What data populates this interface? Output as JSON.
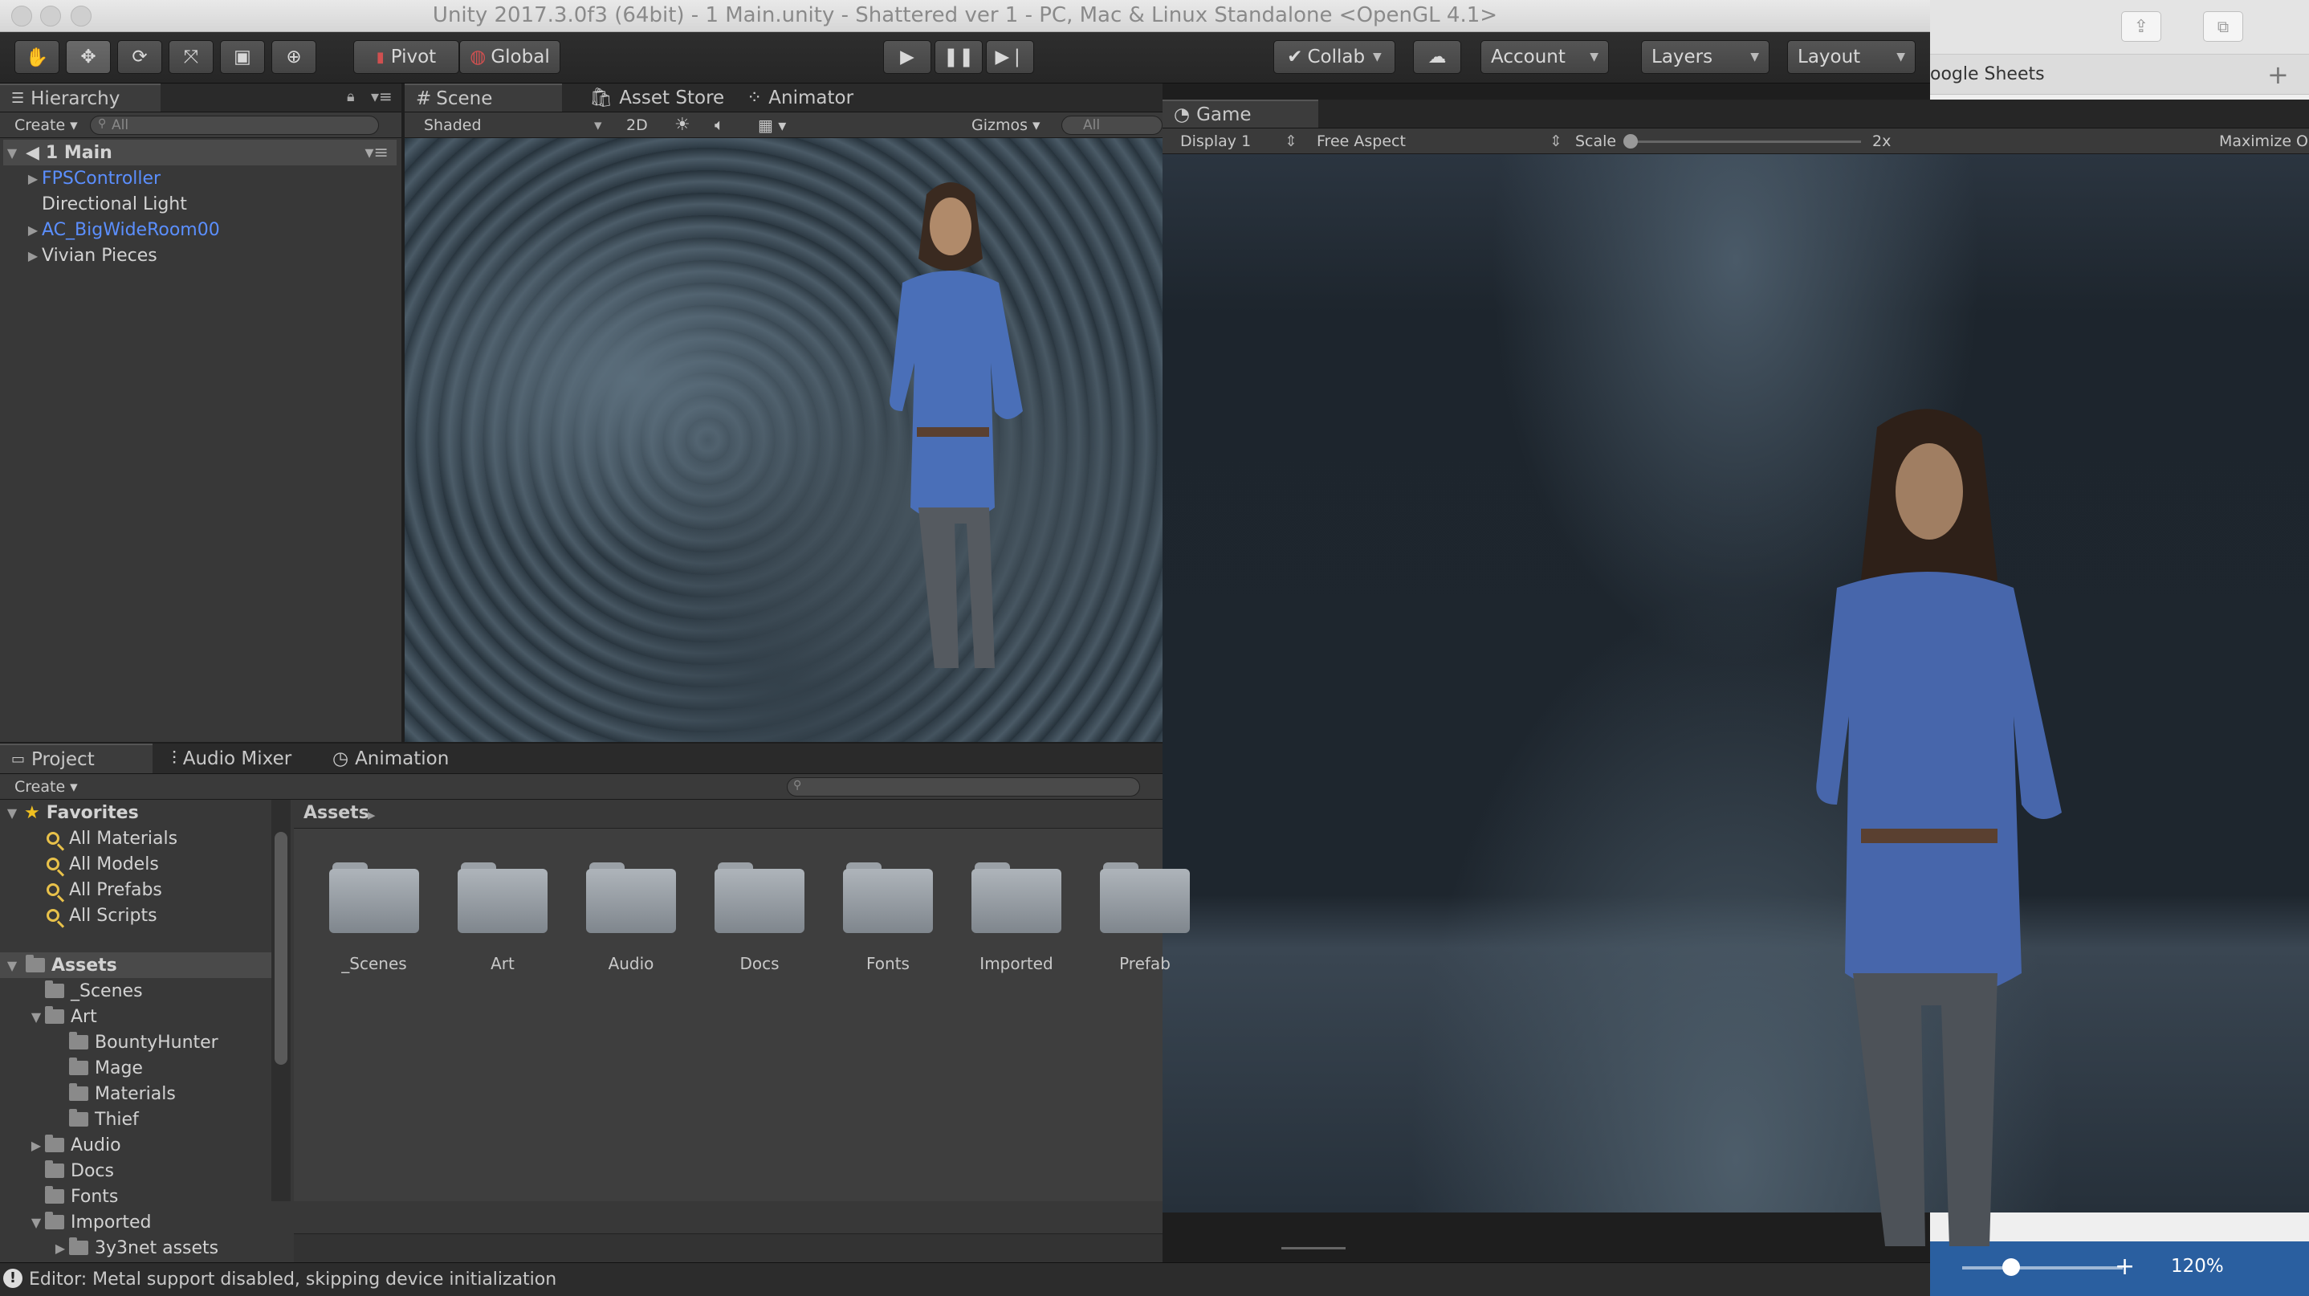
{
  "window": {
    "title": "Unity 2017.3.0f3 (64bit) - 1 Main.unity - Shattered ver 1 - PC, Mac & Linux Standalone <OpenGL 4.1>"
  },
  "toolbar": {
    "tools": [
      "hand-tool",
      "move-tool",
      "rotate-tool",
      "scale-tool",
      "rect-tool",
      "transform-tool"
    ],
    "pivot_label": "Pivot",
    "global_label": "Global",
    "collab_label": "Collab",
    "account_label": "Account",
    "layers_label": "Layers",
    "layout_label": "Layout"
  },
  "hierarchy": {
    "tab_label": "Hierarchy",
    "create_label": "Create",
    "search_placeholder": "All",
    "scene_name": "1 Main",
    "items": [
      {
        "label": "FPSController",
        "prefab": true,
        "expandable": true
      },
      {
        "label": "Directional Light",
        "prefab": false,
        "expandable": false
      },
      {
        "label": "AC_BigWideRoom00",
        "prefab": true,
        "expandable": true
      },
      {
        "label": "Vivian Pieces",
        "prefab": false,
        "expandable": true
      }
    ]
  },
  "scene_view": {
    "tabs": [
      "Scene",
      "Asset Store",
      "Animator"
    ],
    "shading_label": "Shaded",
    "mode_2d_label": "2D",
    "gizmos_label": "Gizmos",
    "search_placeholder": "All"
  },
  "game_view": {
    "tab_label": "Game",
    "display_label": "Display 1",
    "aspect_label": "Free Aspect",
    "scale_label": "Scale",
    "scale_value": "2x",
    "maximize_label": "Maximize O"
  },
  "project": {
    "tabs": [
      "Project",
      "Audio Mixer",
      "Animation"
    ],
    "create_label": "Create",
    "favorites_label": "Favorites",
    "favorites": [
      "All Materials",
      "All Models",
      "All Prefabs",
      "All Scripts"
    ],
    "assets_label": "Assets",
    "tree": [
      {
        "label": "_Scenes",
        "depth": 1,
        "expand": "none"
      },
      {
        "label": "Art",
        "depth": 1,
        "expand": "open"
      },
      {
        "label": "BountyHunter",
        "depth": 2,
        "expand": "none"
      },
      {
        "label": "Mage",
        "depth": 2,
        "expand": "none"
      },
      {
        "label": "Materials",
        "depth": 2,
        "expand": "none"
      },
      {
        "label": "Thief",
        "depth": 2,
        "expand": "none"
      },
      {
        "label": "Audio",
        "depth": 1,
        "expand": "closed"
      },
      {
        "label": "Docs",
        "depth": 1,
        "expand": "none"
      },
      {
        "label": "Fonts",
        "depth": 1,
        "expand": "none"
      },
      {
        "label": "Imported",
        "depth": 1,
        "expand": "open"
      },
      {
        "label": "3y3net assets",
        "depth": 2,
        "expand": "closed"
      }
    ],
    "breadcrumb": "Assets",
    "folders": [
      "_Scenes",
      "Art",
      "Audio",
      "Docs",
      "Fonts",
      "Imported",
      "Prefab"
    ]
  },
  "status_bar": {
    "message": "Editor: Metal support disabled, skipping device initialization"
  },
  "background_window": {
    "tab_label": "oogle Sheets",
    "zoom_label": "120%"
  }
}
